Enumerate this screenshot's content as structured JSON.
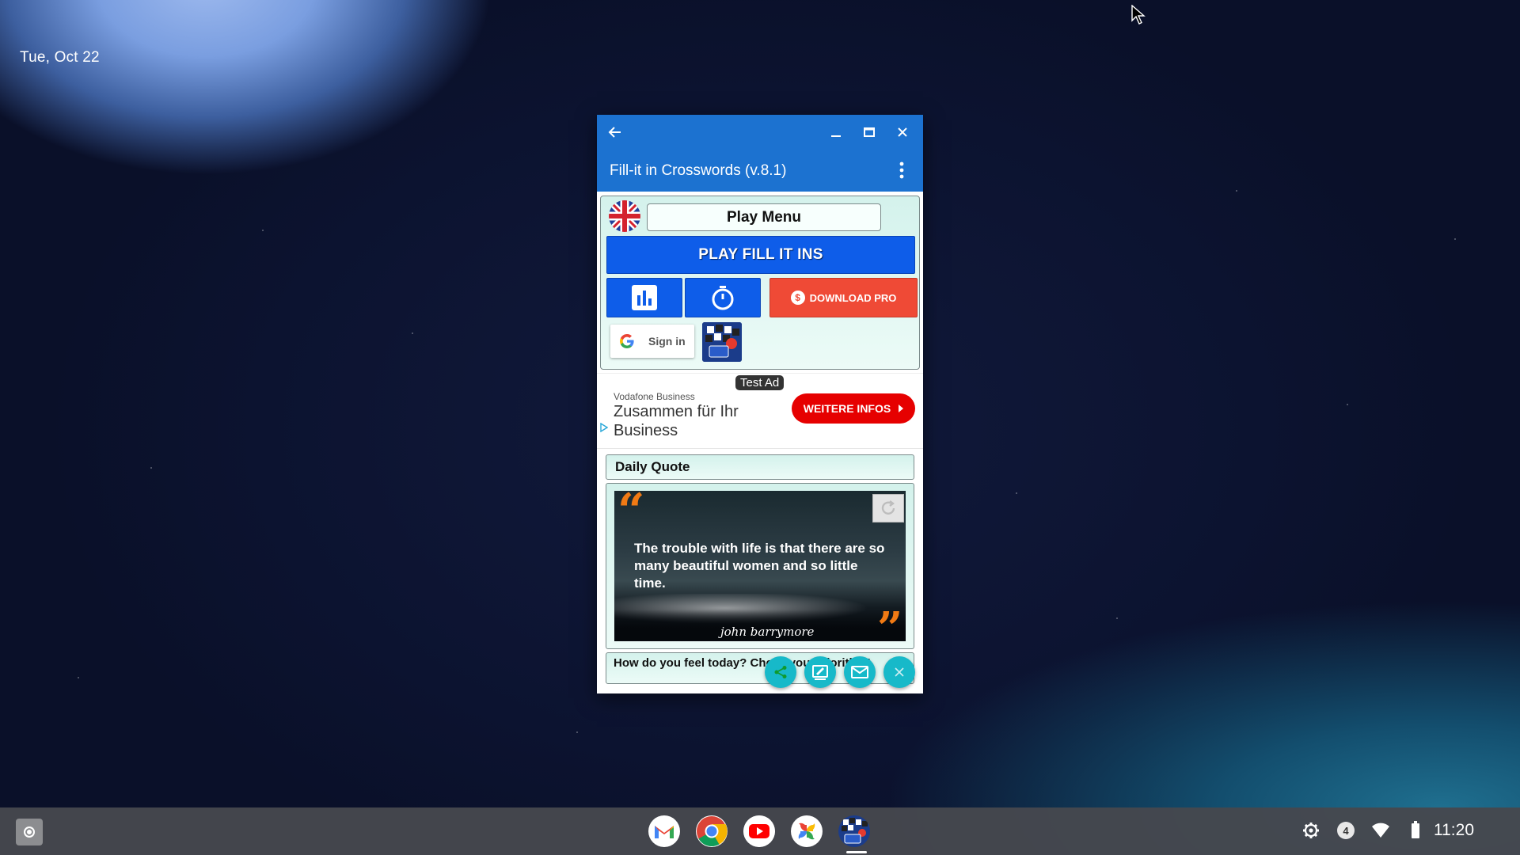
{
  "desktop": {
    "date": "Tue, Oct 22"
  },
  "window": {
    "title": "Fill-it in Crosswords (v.8.1)"
  },
  "play_panel": {
    "menu_label": "Play Menu",
    "play_button": "PLAY FILL IT INS",
    "download_pro": "DOWNLOAD PRO",
    "sign_in": "Sign in"
  },
  "ad": {
    "badge": "Test Ad",
    "advertiser": "Vodafone Business",
    "headline": "Zusammen für Ihr Business",
    "cta": "WEITERE INFOS"
  },
  "daily_quote": {
    "header": "Daily Quote",
    "text": "The trouble with life is that there are so many beautiful women and so little time.",
    "author": "john barrymore"
  },
  "biorhythm": {
    "label": "How do you feel today? Check your Biorithm!"
  },
  "shelf": {
    "apps": [
      "gmail-icon",
      "chrome-icon",
      "youtube-icon",
      "photos-icon",
      "fill-it-in-puzzles-icon"
    ],
    "notification_count": "4",
    "time": "11:20"
  },
  "colors": {
    "titlebar": "#1c72d0",
    "play_button": "#0e5de9",
    "download_button": "#ef4a36",
    "ad_cta": "#e60000",
    "fab": "#17b9c9",
    "quote_mark": "#f07a14"
  }
}
